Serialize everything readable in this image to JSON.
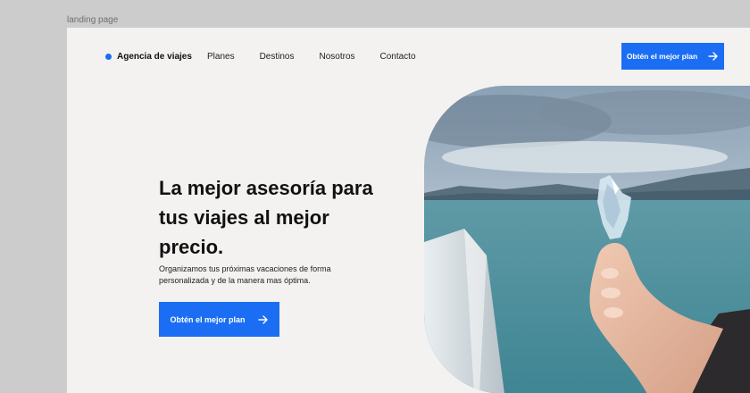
{
  "frame_label": "landing page",
  "brand": {
    "name": "Agencia de viajes"
  },
  "nav": {
    "items": [
      "Planes",
      "Destinos",
      "Nosotros",
      "Contacto"
    ]
  },
  "header_cta": {
    "label": "Obtén el mejor plan",
    "icon": "arrow-right-icon"
  },
  "hero": {
    "title": "La mejor asesoría para tus viajes al mejor precio.",
    "subtitle": "Organizamos tus próximas vacaciones de forma personalizada y de la manera mas óptima.",
    "cta_label": "Obtén el mejor plan"
  },
  "colors": {
    "accent": "#1b6ef3",
    "background": "#f3f2f0",
    "canvas": "#cccccc"
  }
}
